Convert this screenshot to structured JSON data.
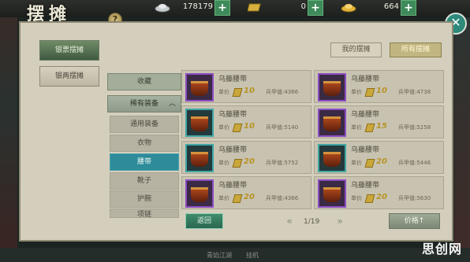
{
  "title": "摆摊",
  "currencies": [
    {
      "icon": "silver-ingot-icon",
      "value": "178179"
    },
    {
      "icon": "gold-bar-icon",
      "value": "0"
    },
    {
      "icon": "gold-ingot-icon",
      "value": "664"
    }
  ],
  "help_label": "?",
  "close_label": "✕",
  "side_buttons": [
    "银票摆摊",
    "银两摆摊"
  ],
  "tabs": {
    "mine": "我的摆摊",
    "all": "所有摆摊"
  },
  "categories": {
    "favorite": "收藏",
    "rare": "稀有装备",
    "subs": [
      "通用装备",
      "衣物",
      "腰带",
      "靴子",
      "护腕",
      "项链"
    ],
    "selected": "腰带"
  },
  "items": [
    {
      "name": "乌藤腰带",
      "price_label": "单价",
      "price": "10",
      "bing": "兵甲值:4366",
      "rarity": "purple"
    },
    {
      "name": "乌藤腰带",
      "price_label": "单价",
      "price": "10",
      "bing": "兵甲值:4738",
      "rarity": "purple"
    },
    {
      "name": "乌藤腰带",
      "price_label": "单价",
      "price": "10",
      "bing": "兵甲值:5140",
      "rarity": "teal"
    },
    {
      "name": "乌藤腰带",
      "price_label": "单价",
      "price": "15",
      "bing": "兵甲值:5258",
      "rarity": "purple"
    },
    {
      "name": "乌藤腰带",
      "price_label": "单价",
      "price": "20",
      "bing": "兵甲值:5752",
      "rarity": "teal"
    },
    {
      "name": "乌藤腰带",
      "price_label": "单价",
      "price": "20",
      "bing": "兵甲值:5446",
      "rarity": "teal"
    },
    {
      "name": "乌藤腰带",
      "price_label": "单价",
      "price": "20",
      "bing": "兵甲值:4366",
      "rarity": "purple"
    },
    {
      "name": "乌藤腰带",
      "price_label": "单价",
      "price": "20",
      "bing": "兵甲值:5630",
      "rarity": "purple"
    }
  ],
  "footer": {
    "back": "返回",
    "page": "1/19",
    "sort": "价格↑"
  },
  "watermark": "思创网",
  "bottom_bar": [
    "青焰江湖",
    "挂机"
  ]
}
